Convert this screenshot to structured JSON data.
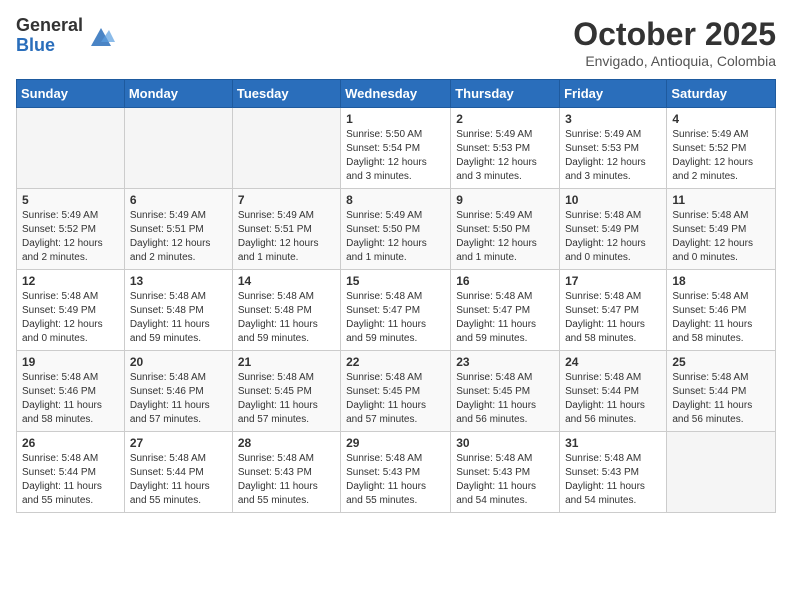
{
  "header": {
    "logo_general": "General",
    "logo_blue": "Blue",
    "month_year": "October 2025",
    "location": "Envigado, Antioquia, Colombia"
  },
  "days_of_week": [
    "Sunday",
    "Monday",
    "Tuesday",
    "Wednesday",
    "Thursday",
    "Friday",
    "Saturday"
  ],
  "weeks": [
    [
      {
        "day": "",
        "content": ""
      },
      {
        "day": "",
        "content": ""
      },
      {
        "day": "",
        "content": ""
      },
      {
        "day": "1",
        "content": "Sunrise: 5:50 AM\nSunset: 5:54 PM\nDaylight: 12 hours\nand 3 minutes."
      },
      {
        "day": "2",
        "content": "Sunrise: 5:49 AM\nSunset: 5:53 PM\nDaylight: 12 hours\nand 3 minutes."
      },
      {
        "day": "3",
        "content": "Sunrise: 5:49 AM\nSunset: 5:53 PM\nDaylight: 12 hours\nand 3 minutes."
      },
      {
        "day": "4",
        "content": "Sunrise: 5:49 AM\nSunset: 5:52 PM\nDaylight: 12 hours\nand 2 minutes."
      }
    ],
    [
      {
        "day": "5",
        "content": "Sunrise: 5:49 AM\nSunset: 5:52 PM\nDaylight: 12 hours\nand 2 minutes."
      },
      {
        "day": "6",
        "content": "Sunrise: 5:49 AM\nSunset: 5:51 PM\nDaylight: 12 hours\nand 2 minutes."
      },
      {
        "day": "7",
        "content": "Sunrise: 5:49 AM\nSunset: 5:51 PM\nDaylight: 12 hours\nand 1 minute."
      },
      {
        "day": "8",
        "content": "Sunrise: 5:49 AM\nSunset: 5:50 PM\nDaylight: 12 hours\nand 1 minute."
      },
      {
        "day": "9",
        "content": "Sunrise: 5:49 AM\nSunset: 5:50 PM\nDaylight: 12 hours\nand 1 minute."
      },
      {
        "day": "10",
        "content": "Sunrise: 5:48 AM\nSunset: 5:49 PM\nDaylight: 12 hours\nand 0 minutes."
      },
      {
        "day": "11",
        "content": "Sunrise: 5:48 AM\nSunset: 5:49 PM\nDaylight: 12 hours\nand 0 minutes."
      }
    ],
    [
      {
        "day": "12",
        "content": "Sunrise: 5:48 AM\nSunset: 5:49 PM\nDaylight: 12 hours\nand 0 minutes."
      },
      {
        "day": "13",
        "content": "Sunrise: 5:48 AM\nSunset: 5:48 PM\nDaylight: 11 hours\nand 59 minutes."
      },
      {
        "day": "14",
        "content": "Sunrise: 5:48 AM\nSunset: 5:48 PM\nDaylight: 11 hours\nand 59 minutes."
      },
      {
        "day": "15",
        "content": "Sunrise: 5:48 AM\nSunset: 5:47 PM\nDaylight: 11 hours\nand 59 minutes."
      },
      {
        "day": "16",
        "content": "Sunrise: 5:48 AM\nSunset: 5:47 PM\nDaylight: 11 hours\nand 59 minutes."
      },
      {
        "day": "17",
        "content": "Sunrise: 5:48 AM\nSunset: 5:47 PM\nDaylight: 11 hours\nand 58 minutes."
      },
      {
        "day": "18",
        "content": "Sunrise: 5:48 AM\nSunset: 5:46 PM\nDaylight: 11 hours\nand 58 minutes."
      }
    ],
    [
      {
        "day": "19",
        "content": "Sunrise: 5:48 AM\nSunset: 5:46 PM\nDaylight: 11 hours\nand 58 minutes."
      },
      {
        "day": "20",
        "content": "Sunrise: 5:48 AM\nSunset: 5:46 PM\nDaylight: 11 hours\nand 57 minutes."
      },
      {
        "day": "21",
        "content": "Sunrise: 5:48 AM\nSunset: 5:45 PM\nDaylight: 11 hours\nand 57 minutes."
      },
      {
        "day": "22",
        "content": "Sunrise: 5:48 AM\nSunset: 5:45 PM\nDaylight: 11 hours\nand 57 minutes."
      },
      {
        "day": "23",
        "content": "Sunrise: 5:48 AM\nSunset: 5:45 PM\nDaylight: 11 hours\nand 56 minutes."
      },
      {
        "day": "24",
        "content": "Sunrise: 5:48 AM\nSunset: 5:44 PM\nDaylight: 11 hours\nand 56 minutes."
      },
      {
        "day": "25",
        "content": "Sunrise: 5:48 AM\nSunset: 5:44 PM\nDaylight: 11 hours\nand 56 minutes."
      }
    ],
    [
      {
        "day": "26",
        "content": "Sunrise: 5:48 AM\nSunset: 5:44 PM\nDaylight: 11 hours\nand 55 minutes."
      },
      {
        "day": "27",
        "content": "Sunrise: 5:48 AM\nSunset: 5:44 PM\nDaylight: 11 hours\nand 55 minutes."
      },
      {
        "day": "28",
        "content": "Sunrise: 5:48 AM\nSunset: 5:43 PM\nDaylight: 11 hours\nand 55 minutes."
      },
      {
        "day": "29",
        "content": "Sunrise: 5:48 AM\nSunset: 5:43 PM\nDaylight: 11 hours\nand 55 minutes."
      },
      {
        "day": "30",
        "content": "Sunrise: 5:48 AM\nSunset: 5:43 PM\nDaylight: 11 hours\nand 54 minutes."
      },
      {
        "day": "31",
        "content": "Sunrise: 5:48 AM\nSunset: 5:43 PM\nDaylight: 11 hours\nand 54 minutes."
      },
      {
        "day": "",
        "content": ""
      }
    ]
  ]
}
